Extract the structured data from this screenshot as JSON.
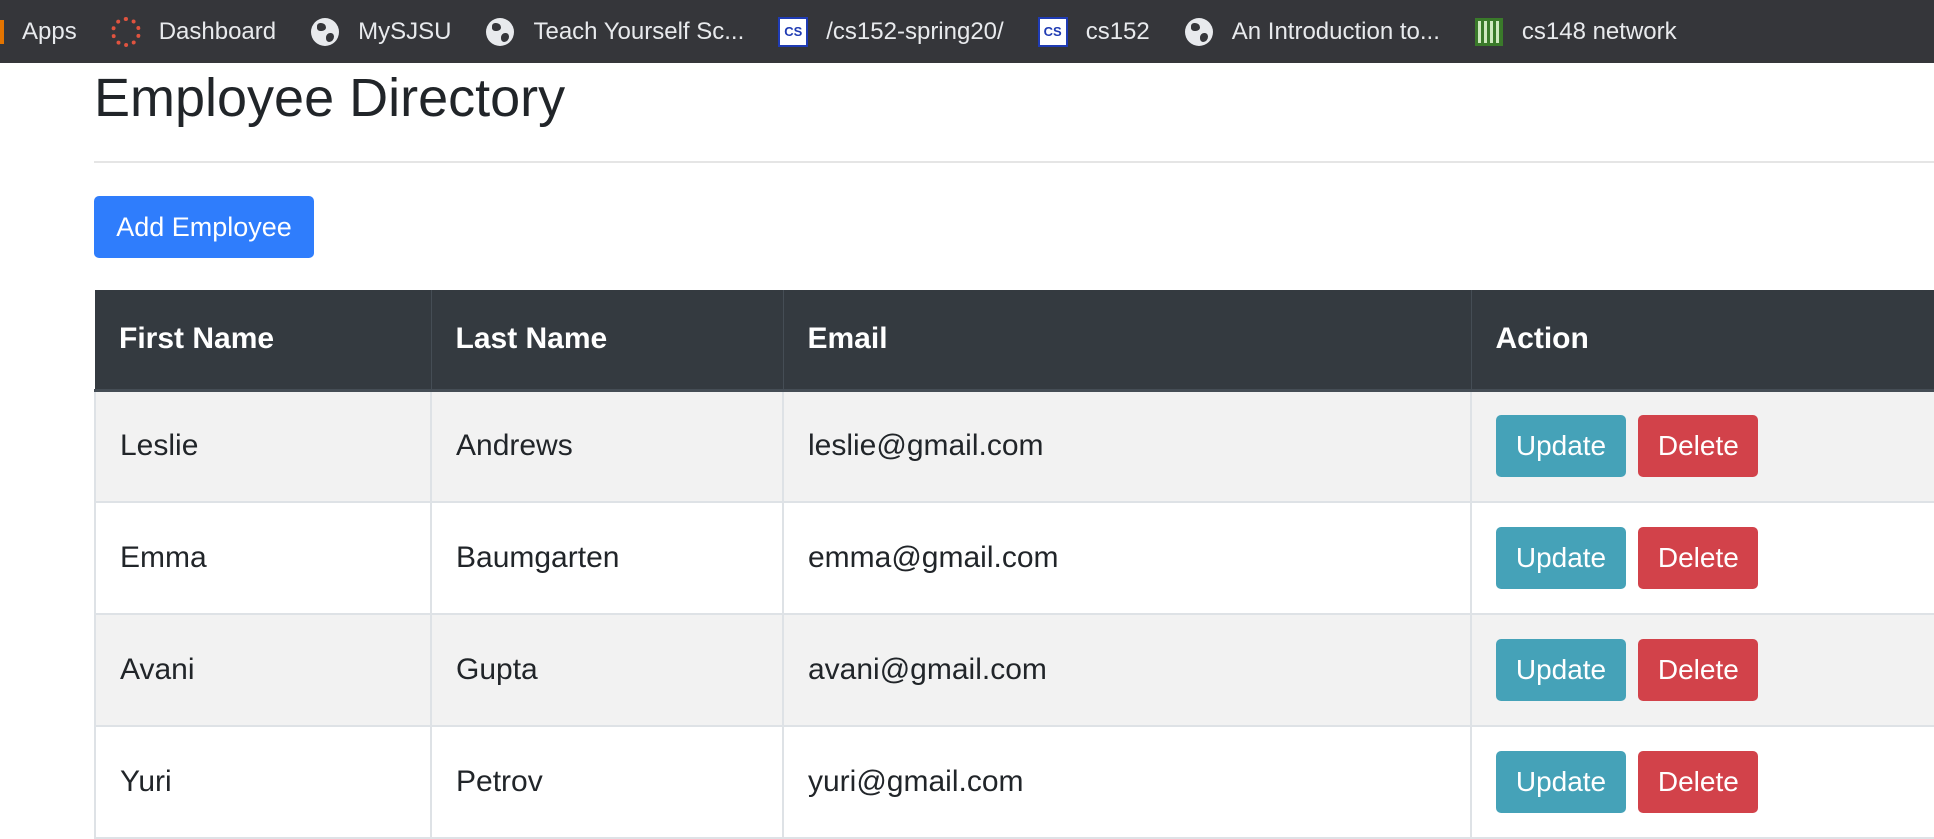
{
  "bookmarks": [
    {
      "label": "Apps",
      "icon": "apps-icon"
    },
    {
      "label": "Dashboard",
      "icon": "canvas-icon"
    },
    {
      "label": "MySJSU",
      "icon": "globe-icon"
    },
    {
      "label": "Teach Yourself Sc...",
      "icon": "globe-icon"
    },
    {
      "label": "/cs152-spring20/",
      "icon": "cs-icon"
    },
    {
      "label": "cs152",
      "icon": "cs-icon"
    },
    {
      "label": "An Introduction to...",
      "icon": "globe-icon"
    },
    {
      "label": "cs148 network",
      "icon": "network-icon"
    }
  ],
  "page": {
    "title": "Employee Directory",
    "add_button": "Add Employee"
  },
  "table": {
    "headers": [
      "First Name",
      "Last Name",
      "Email",
      "Action"
    ],
    "update_label": "Update",
    "delete_label": "Delete",
    "rows": [
      {
        "first": "Leslie",
        "last": "Andrews",
        "email": "leslie@gmail.com"
      },
      {
        "first": "Emma",
        "last": "Baumgarten",
        "email": "emma@gmail.com"
      },
      {
        "first": "Avani",
        "last": "Gupta",
        "email": "avani@gmail.com"
      },
      {
        "first": "Yuri",
        "last": "Petrov",
        "email": "yuri@gmail.com"
      }
    ]
  },
  "colors": {
    "header_bg": "#343a40",
    "primary": "#2f7dfc",
    "info": "#45a2b8",
    "danger": "#d2424a"
  }
}
